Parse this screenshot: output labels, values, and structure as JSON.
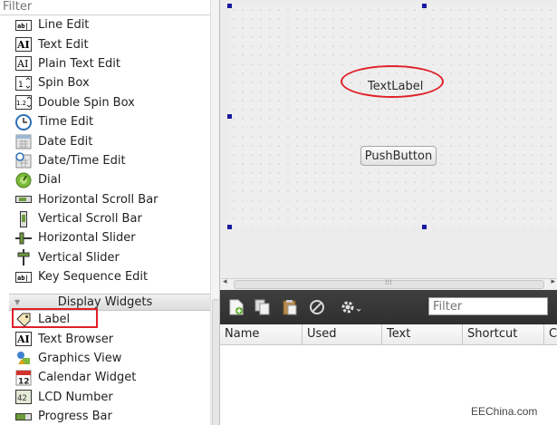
{
  "widget_box": {
    "filter_placeholder": "Filter",
    "items": [
      {
        "label": "Line Edit",
        "icon": "line-edit-icon"
      },
      {
        "label": "Text Edit",
        "icon": "text-edit-icon"
      },
      {
        "label": "Plain Text Edit",
        "icon": "plain-text-edit-icon"
      },
      {
        "label": "Spin Box",
        "icon": "spin-box-icon"
      },
      {
        "label": "Double Spin Box",
        "icon": "double-spin-box-icon"
      },
      {
        "label": "Time Edit",
        "icon": "clock-icon"
      },
      {
        "label": "Date Edit",
        "icon": "calendar-icon"
      },
      {
        "label": "Date/Time Edit",
        "icon": "date-time-icon"
      },
      {
        "label": "Dial",
        "icon": "dial-icon"
      },
      {
        "label": "Horizontal Scroll Bar",
        "icon": "horizontal-scroll-bar-icon"
      },
      {
        "label": "Vertical Scroll Bar",
        "icon": "vertical-scroll-bar-icon"
      },
      {
        "label": "Horizontal Slider",
        "icon": "horizontal-slider-icon"
      },
      {
        "label": "Vertical Slider",
        "icon": "vertical-slider-icon"
      },
      {
        "label": "Key Sequence Edit",
        "icon": "key-sequence-edit-icon"
      }
    ],
    "category": "Display Widgets",
    "display_items": [
      {
        "label": "Label",
        "icon": "label-tag-icon"
      },
      {
        "label": "Text Browser",
        "icon": "text-browser-icon"
      },
      {
        "label": "Graphics View",
        "icon": "graphics-view-icon"
      },
      {
        "label": "Calendar Widget",
        "icon": "calendar-widget-icon"
      },
      {
        "label": "LCD Number",
        "icon": "lcd-number-icon"
      },
      {
        "label": "Progress Bar",
        "icon": "progress-bar-icon"
      }
    ]
  },
  "form": {
    "text_label": "TextLabel",
    "push_button": "PushButton"
  },
  "action_editor": {
    "filter_placeholder": "Filter",
    "columns": [
      "Name",
      "Used",
      "Text",
      "Shortcut",
      "C"
    ]
  },
  "watermark": "EEChina.com",
  "colors": {
    "highlight_red": "#e0202a",
    "handle_blue": "#1a1aa0",
    "toolbar_dark": "#353535"
  }
}
